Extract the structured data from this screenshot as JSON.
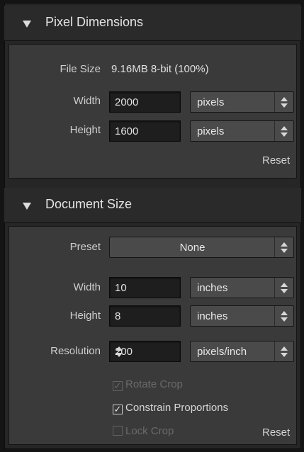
{
  "pixel_dimensions": {
    "title": "Pixel Dimensions",
    "file_size_label": "File Size",
    "file_size_value": "9.16MB 8-bit (100%)",
    "width_label": "Width",
    "width_value": "2000",
    "width_unit": "pixels",
    "height_label": "Height",
    "height_value": "1600",
    "height_unit": "pixels",
    "reset_label": "Reset"
  },
  "document_size": {
    "title": "Document Size",
    "preset_label": "Preset",
    "preset_value": "None",
    "width_label": "Width",
    "width_value": "10",
    "width_unit": "inches",
    "height_label": "Height",
    "height_value": "8",
    "height_unit": "inches",
    "resolution_label": "Resolution",
    "resolution_value": "200",
    "resolution_unit": "pixels/inch",
    "rotate_crop_label": "Rotate Crop",
    "rotate_crop_checked": true,
    "rotate_crop_enabled": false,
    "constrain_label": "Constrain Proportions",
    "constrain_checked": true,
    "lock_crop_label": "Lock Crop",
    "lock_crop_checked": false,
    "lock_crop_enabled": false,
    "reset_label": "Reset"
  }
}
